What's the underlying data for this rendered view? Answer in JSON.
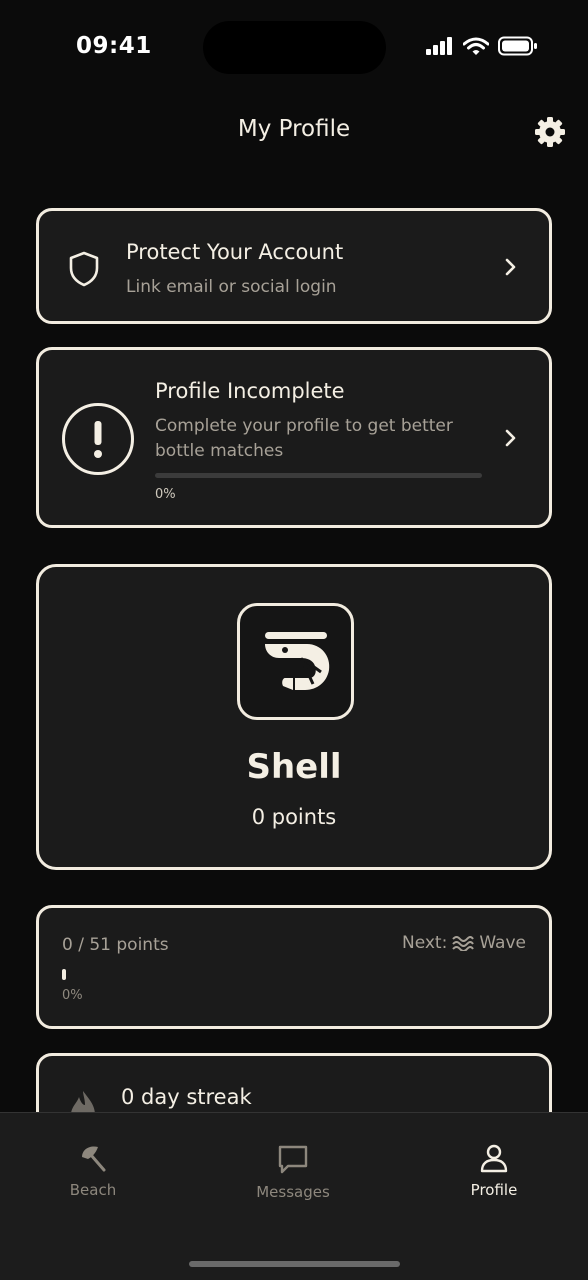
{
  "status": {
    "time": "09:41"
  },
  "header": {
    "title": "My Profile"
  },
  "protect": {
    "title": "Protect Your Account",
    "subtitle": "Link email or social login"
  },
  "incomplete": {
    "title": "Profile Incomplete",
    "subtitle_line1": "Complete your profile to get better",
    "subtitle_line2": "bottle matches",
    "progress": 0,
    "progress_label": "0%"
  },
  "rank": {
    "name": "Shell",
    "points": "0 points"
  },
  "progress": {
    "points_label": "0 / 51 points",
    "next_prefix": "Next:",
    "next_rank": "Wave",
    "progress": 0,
    "percent_label": "0%"
  },
  "streak": {
    "label": "0 day streak"
  },
  "tabs": [
    {
      "label": "Beach",
      "icon": "umbrella-icon"
    },
    {
      "label": "Messages",
      "icon": "message-icon"
    },
    {
      "label": "Profile",
      "icon": "person-icon"
    }
  ],
  "colors": {
    "background": "#0b0b0b",
    "card": "#1b1b1b",
    "accent": "#f2ece0"
  }
}
